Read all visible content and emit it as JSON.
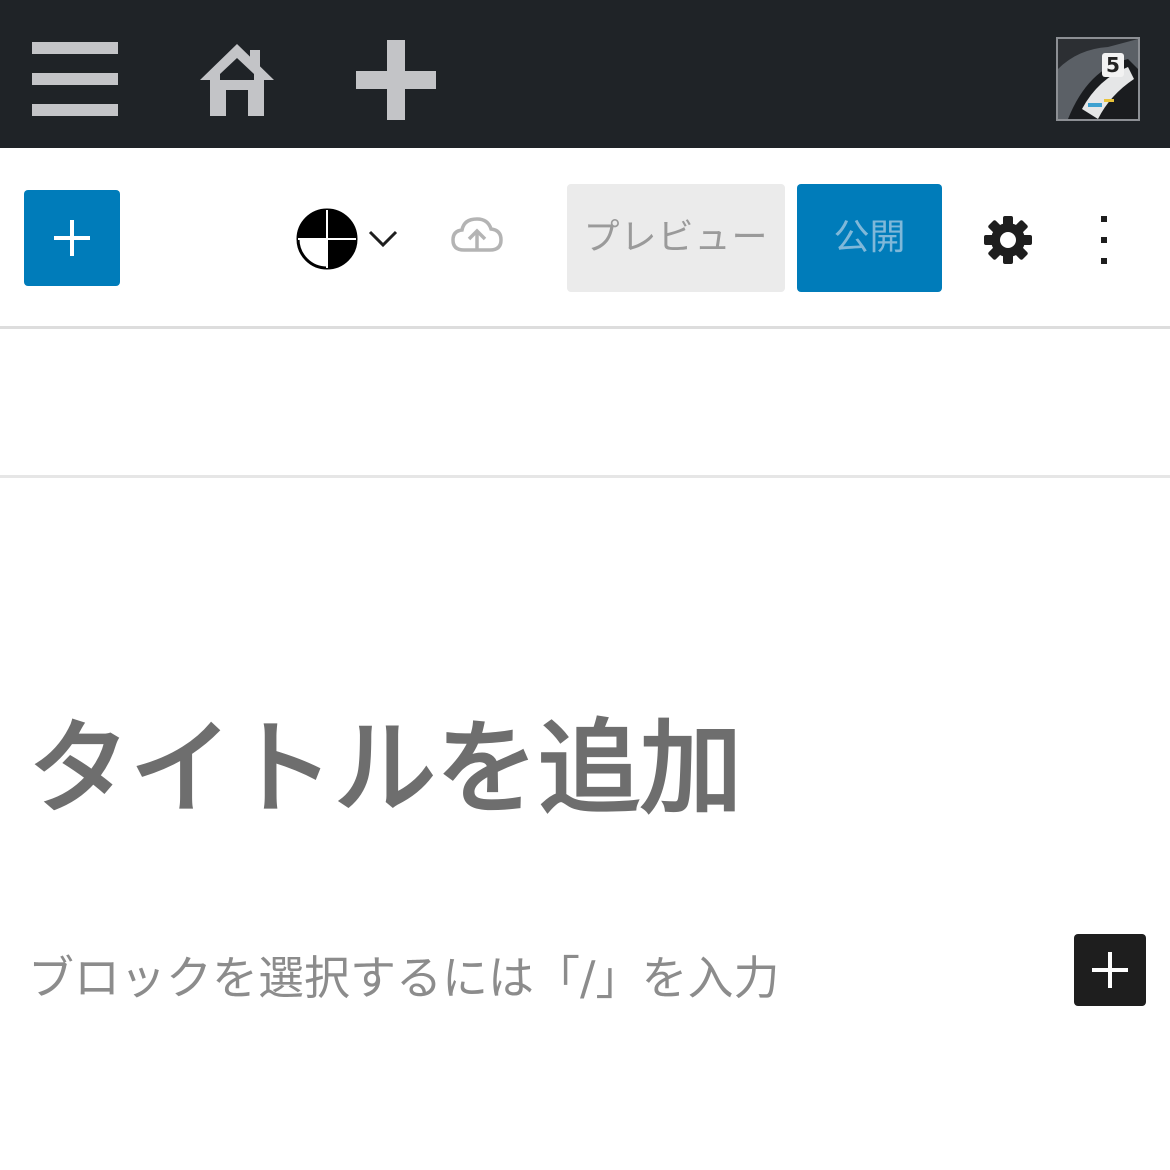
{
  "admin_bar": {
    "icons": [
      "menu-icon",
      "home-icon",
      "plus-icon"
    ],
    "avatar": "user-avatar"
  },
  "toolbar": {
    "inserter_icon": "plus-icon",
    "style_toggle_icon": "half-circle-icon",
    "save_status_icon": "cloud-upload-icon",
    "preview_label": "プレビュー",
    "publish_label": "公開",
    "settings_icon": "gear-icon",
    "more_icon": "vertical-ellipsis-icon",
    "accent_color": "#007cba"
  },
  "editor": {
    "title_placeholder": "タイトルを追加",
    "block_placeholder": "ブロックを選択するには「/」を入力",
    "add_block_icon": "plus-icon"
  }
}
